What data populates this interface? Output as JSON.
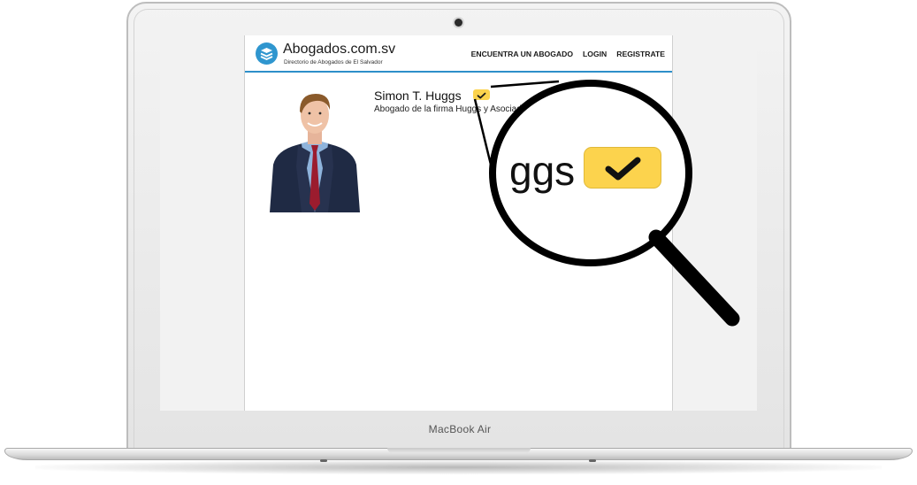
{
  "device": {
    "brand_label": "MacBook Air"
  },
  "site": {
    "logo_title": "Abogados.com.sv",
    "logo_subtitle": "Directorio de Abogados de El Salvador",
    "accent_color": "#2d8fc9"
  },
  "nav": {
    "items": [
      {
        "label": "ENCUENTRA UN ABOGADO"
      },
      {
        "label": "LOGIN"
      },
      {
        "label": "REGISTRATE"
      }
    ]
  },
  "profile": {
    "name": "Simon T. Huggs",
    "subtitle": "Abogado de la firma Huggs y Asociados",
    "verified_badge_color": "#fcd34d",
    "verified_icon": "checkmark-icon"
  },
  "magnifier": {
    "zoomed_text": "ggs"
  }
}
